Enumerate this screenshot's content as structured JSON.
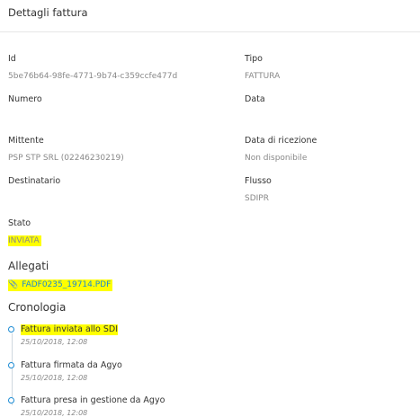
{
  "header": {
    "title": "Dettagli fattura"
  },
  "fields": {
    "id": {
      "label": "Id",
      "value": "5be76b64-98fe-4771-9b74-c359ccfe477d"
    },
    "tipo": {
      "label": "Tipo",
      "value": "FATTURA"
    },
    "numero": {
      "label": "Numero",
      "value": ""
    },
    "data": {
      "label": "Data",
      "value": ""
    },
    "mittente": {
      "label": "Mittente",
      "value": "PSP STP SRL (02246230219)"
    },
    "data_ricezione": {
      "label": "Data di ricezione",
      "value": "Non disponibile"
    },
    "destinatario": {
      "label": "Destinatario",
      "value": ""
    },
    "flusso": {
      "label": "Flusso",
      "value": "SDIPR"
    },
    "stato": {
      "label": "Stato",
      "value": "INVIATA"
    }
  },
  "allegati": {
    "title": "Allegati",
    "files": [
      {
        "name": "FADF0235_19714.PDF",
        "icon": "paperclip-icon"
      }
    ]
  },
  "cronologia": {
    "title": "Cronologia",
    "events": [
      {
        "title": "Fattura inviata allo SDI",
        "date": "25/10/2018, 12:08"
      },
      {
        "title": "Fattura firmata da Agyo",
        "date": "25/10/2018, 12:08"
      },
      {
        "title": "Fattura presa in gestione da Agyo",
        "date": "25/10/2018, 12:08"
      }
    ]
  },
  "colors": {
    "accent": "#1a8ad3",
    "highlight": "#ffff00",
    "muted": "#888888"
  }
}
